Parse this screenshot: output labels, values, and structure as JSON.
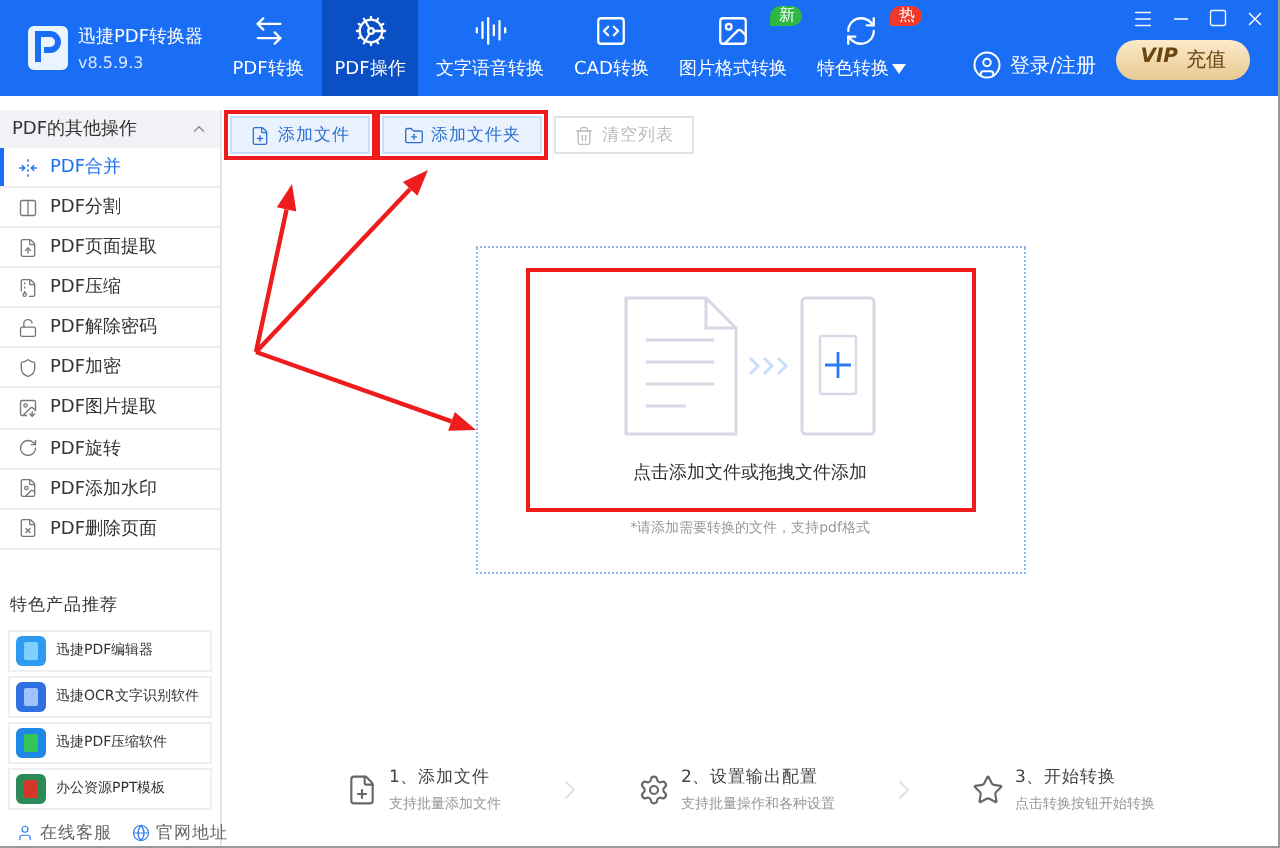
{
  "app": {
    "name": "迅捷PDF转换器",
    "version": "v8.5.9.3"
  },
  "nav_tabs": [
    {
      "label": "PDF转换",
      "selected": false
    },
    {
      "label": "PDF操作",
      "selected": true
    },
    {
      "label": "文字语音转换",
      "selected": false
    },
    {
      "label": "CAD转换",
      "selected": false
    },
    {
      "label": "图片格式转换",
      "selected": false,
      "badge": {
        "text": "新",
        "color": "#2db843"
      }
    },
    {
      "label": "特色转换",
      "selected": false,
      "has_menu": true,
      "badge": {
        "text": "热",
        "color": "#f0392b"
      }
    }
  ],
  "account": {
    "login": "登录/注册",
    "vip": "VIP",
    "vip_action": "充值"
  },
  "sidebar": {
    "section_title": "PDF的其他操作",
    "expanded": true,
    "items": [
      {
        "label": "PDF合并",
        "selected": true
      },
      {
        "label": "PDF分割",
        "selected": false
      },
      {
        "label": "PDF页面提取",
        "selected": false
      },
      {
        "label": "PDF压缩",
        "selected": false
      },
      {
        "label": "PDF解除密码",
        "selected": false
      },
      {
        "label": "PDF加密",
        "selected": false
      },
      {
        "label": "PDF图片提取",
        "selected": false
      },
      {
        "label": "PDF旋转",
        "selected": false
      },
      {
        "label": "PDF添加水印",
        "selected": false
      },
      {
        "label": "PDF删除页面",
        "selected": false
      }
    ],
    "promo_title": "特色产品推荐",
    "products": [
      {
        "label": "迅捷PDF编辑器"
      },
      {
        "label": "迅捷OCR文字识别软件"
      },
      {
        "label": "迅捷PDF压缩软件"
      },
      {
        "label": "办公资源PPT模板"
      }
    ],
    "footer_links": [
      {
        "label": "在线客服"
      },
      {
        "label": "官网地址"
      }
    ]
  },
  "toolbar": [
    {
      "label": "添加文件",
      "disabled": false
    },
    {
      "label": "添加文件夹",
      "disabled": false
    },
    {
      "label": "清空列表",
      "disabled": true
    }
  ],
  "dropzone": {
    "title": "点击添加文件或拖拽文件添加",
    "hint": "*请添加需要转换的文件，支持pdf格式"
  },
  "steps": [
    {
      "title": "1、添加文件",
      "subtitle": "支持批量添加文件"
    },
    {
      "title": "2、设置输出配置",
      "subtitle": "支持批量操作和各种设置"
    },
    {
      "title": "3、开始转换",
      "subtitle": "点击转换按钮开始转换"
    }
  ]
}
